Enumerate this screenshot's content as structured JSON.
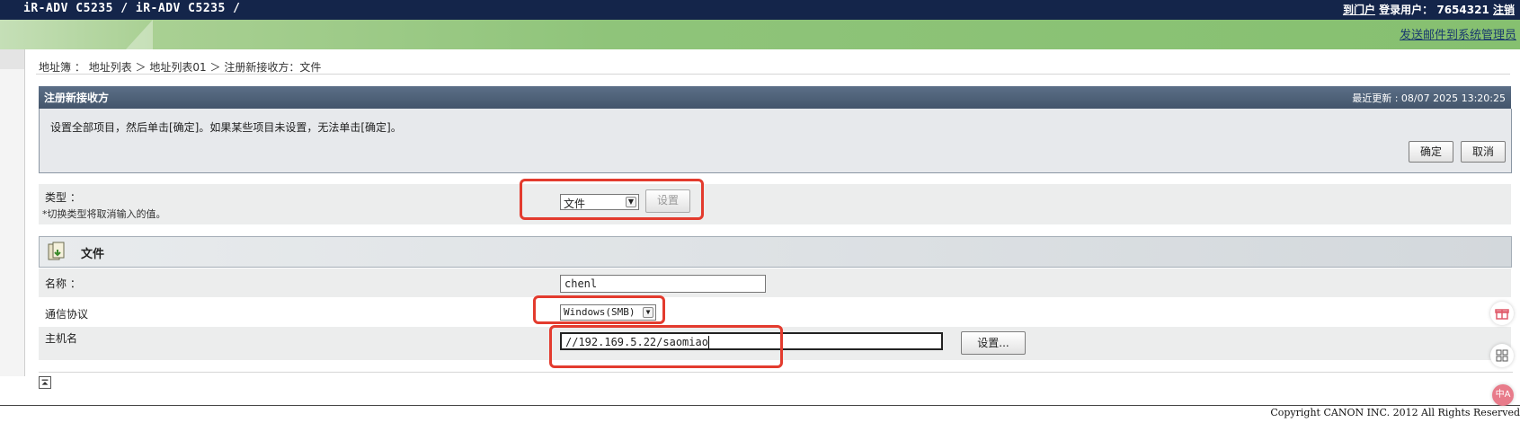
{
  "header": {
    "title": "iR-ADV C5235 / iR-ADV C5235 /",
    "link_text": "到门户",
    "user_label": "登录用户：",
    "user_id": "7654321",
    "logout_text": "注销",
    "send_mail_link": "发送邮件到系统管理员"
  },
  "breadcrumb": {
    "items": [
      "地址簿",
      "地址列表",
      "地址列表01",
      "注册新接收方：文件"
    ],
    "sep1": "：",
    "sep2": "＞",
    "sep3": "＞"
  },
  "panel": {
    "title": "注册新接收方",
    "last_updated_label": "最近更新",
    "last_updated": "08/07 2025 13:20:25",
    "instruction": "设置全部项目，然后单击[确定]。如果某些项目未设置，无法单击[确定]。",
    "ok_label": "确定",
    "cancel_label": "取消"
  },
  "type_row": {
    "label": "类型",
    "colon": "：",
    "note": "*切换类型将取消输入的值。",
    "selected": "文件",
    "set_label": "设置"
  },
  "file_section": {
    "title": "文件",
    "name_label": "名称",
    "name_colon": "：",
    "name_value": "chenl",
    "protocol_label": "通信协议",
    "protocol_selected": "Windows(SMB)",
    "host_label": "主机名",
    "host_value": "//192.169.5.22/saomiao",
    "host_button": "设置..."
  },
  "footer": {
    "copyright": "Copyright CANON INC. 2012 All Rights Reserved"
  },
  "floating": {
    "translate_label": "中A"
  }
}
